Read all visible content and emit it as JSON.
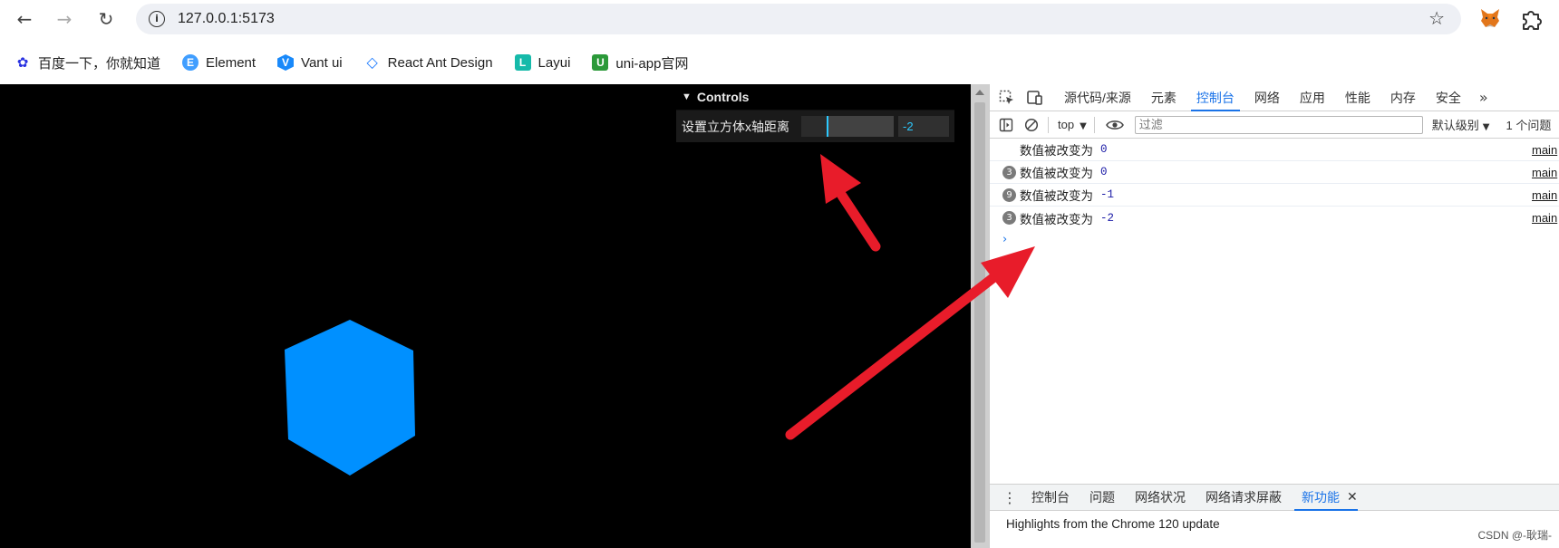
{
  "browser": {
    "url": "127.0.0.1:5173",
    "bookmarks": [
      {
        "label": "百度一下，你就知道",
        "icon": "baidu-paw-icon",
        "color": "#2932e1"
      },
      {
        "label": "Element",
        "icon": "element-icon",
        "color": "#409eff"
      },
      {
        "label": "Vant ui",
        "icon": "vant-icon",
        "color": "#1989fa"
      },
      {
        "label": "React Ant Design",
        "icon": "ant-design-icon",
        "color": "#1677ff"
      },
      {
        "label": "Layui",
        "icon": "layui-icon",
        "color": "#16baaa"
      },
      {
        "label": "uni-app官网",
        "icon": "uniapp-icon",
        "color": "#2b9939"
      }
    ]
  },
  "gui": {
    "title": "Controls",
    "controls": [
      {
        "label": "设置立方体x轴距离",
        "value": "-2",
        "fraction": 0.27
      }
    ]
  },
  "devtools": {
    "tabs": [
      "源代码/来源",
      "元素",
      "控制台",
      "网络",
      "应用",
      "性能",
      "内存",
      "安全"
    ],
    "active_tab": "控制台",
    "toolbar": {
      "context": "top",
      "filter_placeholder": "过滤",
      "level": "默认级别",
      "issues": "1 个问题"
    },
    "logs": [
      {
        "count": "",
        "message": "数值被改变为",
        "value": "0",
        "source": "main"
      },
      {
        "count": "3",
        "message": "数值被改变为",
        "value": "0",
        "source": "main"
      },
      {
        "count": "9",
        "message": "数值被改变为",
        "value": "-1",
        "source": "main"
      },
      {
        "count": "3",
        "message": "数值被改变为",
        "value": "-2",
        "source": "main"
      }
    ],
    "drawer": {
      "tabs": [
        "控制台",
        "问题",
        "网络状况",
        "网络请求屏蔽",
        "新功能"
      ],
      "active_tab": "新功能",
      "highlight": "Highlights from the Chrome 120 update"
    }
  },
  "colors": {
    "cube": "#0090ff",
    "arrow": "#e81c2a",
    "accent": "#1a73e8",
    "gui_number": "#2cc9ff"
  },
  "watermark": "CSDN @-耿瑞-"
}
